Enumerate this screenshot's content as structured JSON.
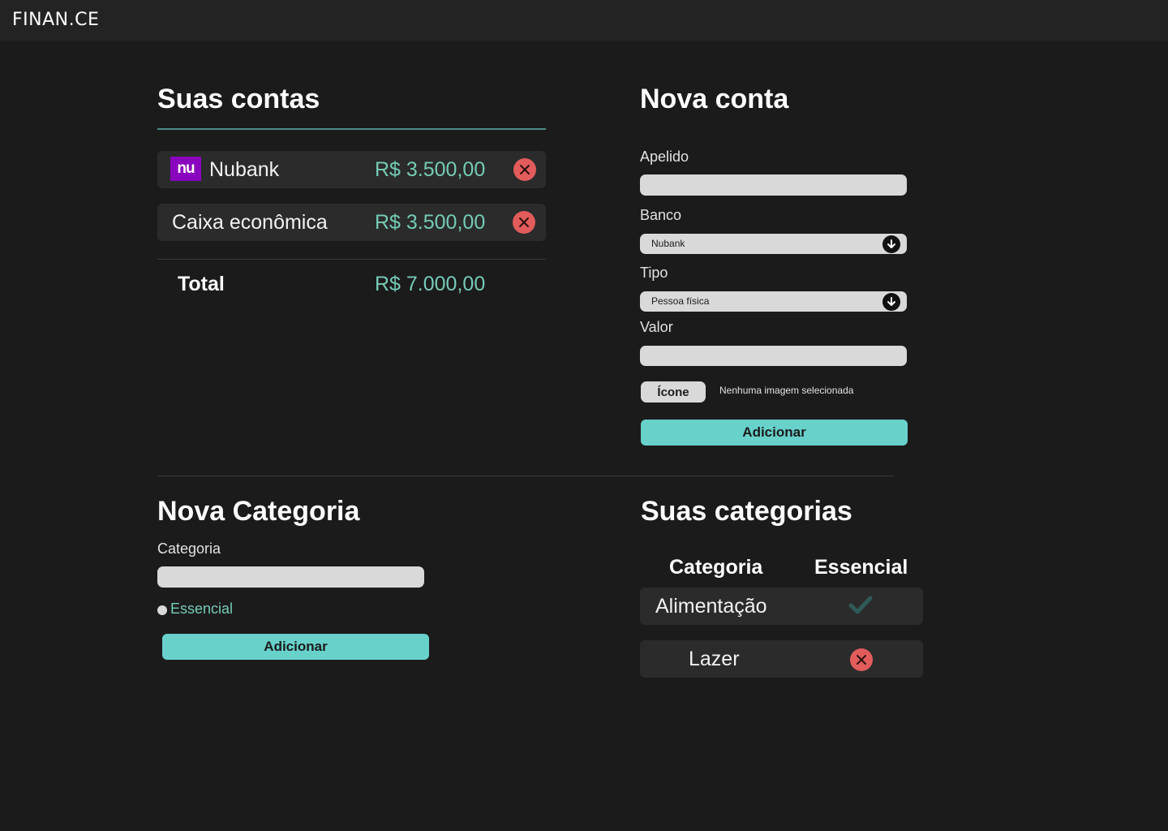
{
  "app": {
    "brand": "FINAN.CE"
  },
  "accounts": {
    "title": "Suas contas",
    "items": [
      {
        "name": "Nubank",
        "value": "R$ 3.500,00",
        "logo_text": "nu",
        "logo_color": "#8a05be"
      },
      {
        "name": "Caixa econômica",
        "value": "R$ 3.500,00"
      }
    ],
    "total_label": "Total",
    "total_value": "R$ 7.000,00"
  },
  "new_account": {
    "title": "Nova conta",
    "nickname_label": "Apelido",
    "nickname_value": "",
    "bank_label": "Banco",
    "bank_selected": "Nubank",
    "type_label": "Tipo",
    "type_selected": "Pessoa física",
    "value_label": "Valor",
    "value_value": "",
    "icon_button": "Ícone",
    "icon_status": "Nenhuma imagem selecionada",
    "submit": "Adicionar"
  },
  "new_category": {
    "title": "Nova Categoria",
    "category_label": "Categoria",
    "category_value": "",
    "essential_label": "Essencial",
    "submit": "Adicionar"
  },
  "categories": {
    "title": "Suas categorias",
    "col_category": "Categoria",
    "col_essential": "Essencial",
    "items": [
      {
        "name": "Alimentação",
        "essential": true,
        "status_icon": "check-icon"
      },
      {
        "name": "Lazer",
        "essential": false,
        "status_icon": "close-icon"
      }
    ]
  },
  "colors": {
    "background": "#1c1b1c",
    "accent": "#67d1ca",
    "money": "#74cbb6",
    "danger": "#e25c5c",
    "check": "#2f5a57"
  }
}
